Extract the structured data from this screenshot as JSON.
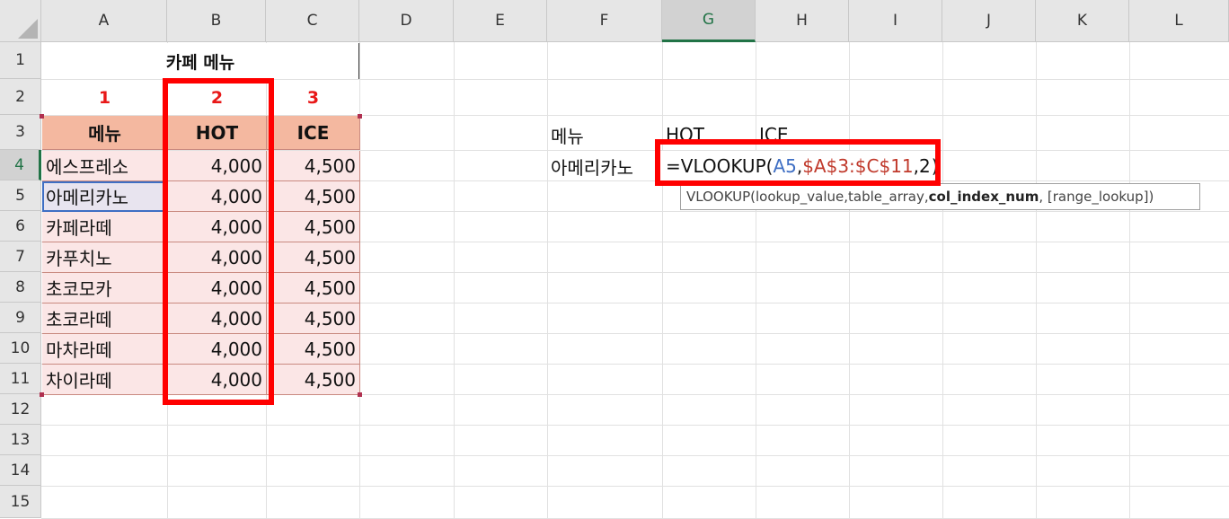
{
  "columns": [
    "A",
    "B",
    "C",
    "D",
    "E",
    "F",
    "G",
    "H",
    "I",
    "J",
    "K",
    "L"
  ],
  "rows": [
    "1",
    "2",
    "3",
    "4",
    "5",
    "6",
    "7",
    "8",
    "9",
    "10",
    "11",
    "12",
    "13",
    "14",
    "15"
  ],
  "active_column": "G",
  "active_row": "4",
  "title": "카페 메뉴",
  "col_indices": [
    "1",
    "2",
    "3"
  ],
  "table": {
    "headers": [
      "메뉴",
      "HOT",
      "ICE"
    ],
    "rows": [
      {
        "menu": "에스프레소",
        "hot": "4,000",
        "ice": "4,500"
      },
      {
        "menu": "아메리카노",
        "hot": "4,000",
        "ice": "4,500"
      },
      {
        "menu": "카페라떼",
        "hot": "4,000",
        "ice": "4,500"
      },
      {
        "menu": "카푸치노",
        "hot": "4,000",
        "ice": "4,500"
      },
      {
        "menu": "초코모카",
        "hot": "4,000",
        "ice": "4,500"
      },
      {
        "menu": "초코라떼",
        "hot": "4,000",
        "ice": "4,500"
      },
      {
        "menu": "마차라떼",
        "hot": "4,000",
        "ice": "4,500"
      },
      {
        "menu": "차이라떼",
        "hot": "4,000",
        "ice": "4,500"
      }
    ]
  },
  "lookup": {
    "label_menu": "메뉴",
    "label_hot": "HOT",
    "label_ice": "ICE",
    "value_menu": "아메리카노",
    "formula": {
      "prefix": "=VLOOKUP(",
      "ref1": "A5",
      "sep1": ",",
      "ref2": "$A$3:$C$11",
      "sep2": ",",
      "arg3": "2",
      "suffix": ")"
    }
  },
  "tooltip": {
    "fn": "VLOOKUP(",
    "arg1": "lookup_value, ",
    "arg2": "table_array, ",
    "arg3": "col_index_num",
    "arg4": ", [range_lookup])"
  },
  "colors": {
    "header_fill": "#f4b8a0",
    "body_fill": "#fbe6e6",
    "highlight_box": "#ff0000",
    "index_text": "#e81818",
    "ref_blue": "#3f6fc4",
    "ref_red": "#c0392b",
    "excel_green": "#217346"
  }
}
